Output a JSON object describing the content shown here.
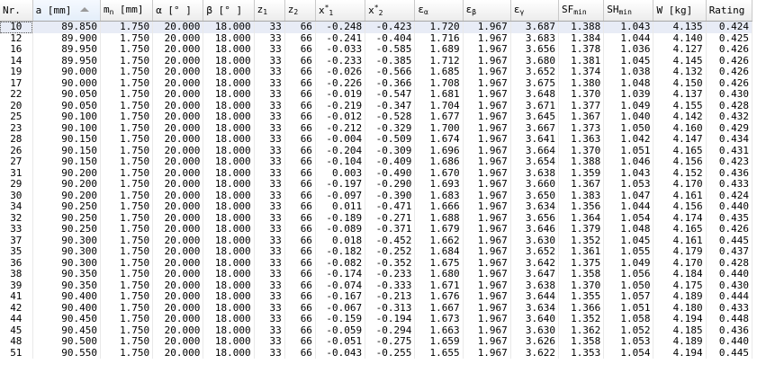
{
  "columns": [
    {
      "key": "nr",
      "label": "Nr."
    },
    {
      "key": "a",
      "label": "a [mm]",
      "sorted": "asc"
    },
    {
      "key": "mn",
      "label": "m",
      "sub": "n",
      "after": " [mm]"
    },
    {
      "key": "alpha",
      "label": "α [° ]"
    },
    {
      "key": "beta",
      "label": "β [° ]"
    },
    {
      "key": "z1",
      "label": "z",
      "sub": "1"
    },
    {
      "key": "z2",
      "label": "z",
      "sub": "2"
    },
    {
      "key": "x1",
      "label": "x",
      "sup": "*",
      "sub": "1"
    },
    {
      "key": "x2",
      "label": "x",
      "sup": "*",
      "sub": "2"
    },
    {
      "key": "ea",
      "label": "ε",
      "sub": "α"
    },
    {
      "key": "eb",
      "label": "ε",
      "sub": "β"
    },
    {
      "key": "eg",
      "label": "ε",
      "sub": "γ"
    },
    {
      "key": "sfmin",
      "label": "SF",
      "sub": "min"
    },
    {
      "key": "shmin",
      "label": "SH",
      "sub": "min"
    },
    {
      "key": "w",
      "label": "W [kg]"
    },
    {
      "key": "rating",
      "label": "Rating"
    }
  ],
  "rows": [
    [
      "10",
      "89.850",
      "1.750",
      "20.000",
      "18.000",
      "33",
      "66",
      "-0.248",
      "-0.423",
      "1.720",
      "1.967",
      "3.687",
      "1.388",
      "1.043",
      "4.135",
      "0.424"
    ],
    [
      "12",
      "89.900",
      "1.750",
      "20.000",
      "18.000",
      "33",
      "66",
      "-0.241",
      "-0.404",
      "1.716",
      "1.967",
      "3.683",
      "1.384",
      "1.044",
      "4.140",
      "0.425"
    ],
    [
      "16",
      "89.950",
      "1.750",
      "20.000",
      "18.000",
      "33",
      "66",
      "-0.033",
      "-0.585",
      "1.689",
      "1.967",
      "3.656",
      "1.378",
      "1.036",
      "4.127",
      "0.426"
    ],
    [
      "14",
      "89.950",
      "1.750",
      "20.000",
      "18.000",
      "33",
      "66",
      "-0.233",
      "-0.385",
      "1.712",
      "1.967",
      "3.680",
      "1.381",
      "1.045",
      "4.145",
      "0.426"
    ],
    [
      "19",
      "90.000",
      "1.750",
      "20.000",
      "18.000",
      "33",
      "66",
      "-0.026",
      "-0.566",
      "1.685",
      "1.967",
      "3.652",
      "1.374",
      "1.038",
      "4.132",
      "0.426"
    ],
    [
      "17",
      "90.000",
      "1.750",
      "20.000",
      "18.000",
      "33",
      "66",
      "-0.226",
      "-0.366",
      "1.708",
      "1.967",
      "3.675",
      "1.380",
      "1.048",
      "4.150",
      "0.426"
    ],
    [
      "22",
      "90.050",
      "1.750",
      "20.000",
      "18.000",
      "33",
      "66",
      "-0.019",
      "-0.547",
      "1.681",
      "1.967",
      "3.648",
      "1.370",
      "1.039",
      "4.137",
      "0.430"
    ],
    [
      "20",
      "90.050",
      "1.750",
      "20.000",
      "18.000",
      "33",
      "66",
      "-0.219",
      "-0.347",
      "1.704",
      "1.967",
      "3.671",
      "1.377",
      "1.049",
      "4.155",
      "0.428"
    ],
    [
      "25",
      "90.100",
      "1.750",
      "20.000",
      "18.000",
      "33",
      "66",
      "-0.012",
      "-0.528",
      "1.677",
      "1.967",
      "3.645",
      "1.367",
      "1.040",
      "4.142",
      "0.432"
    ],
    [
      "23",
      "90.100",
      "1.750",
      "20.000",
      "18.000",
      "33",
      "66",
      "-0.212",
      "-0.329",
      "1.700",
      "1.967",
      "3.667",
      "1.373",
      "1.050",
      "4.160",
      "0.429"
    ],
    [
      "28",
      "90.150",
      "1.750",
      "20.000",
      "18.000",
      "33",
      "66",
      "-0.004",
      "-0.509",
      "1.674",
      "1.967",
      "3.641",
      "1.363",
      "1.042",
      "4.147",
      "0.434"
    ],
    [
      "26",
      "90.150",
      "1.750",
      "20.000",
      "18.000",
      "33",
      "66",
      "-0.204",
      "-0.309",
      "1.696",
      "1.967",
      "3.664",
      "1.370",
      "1.051",
      "4.165",
      "0.431"
    ],
    [
      "27",
      "90.150",
      "1.750",
      "20.000",
      "18.000",
      "33",
      "66",
      "-0.104",
      "-0.409",
      "1.686",
      "1.967",
      "3.654",
      "1.388",
      "1.046",
      "4.156",
      "0.423"
    ],
    [
      "31",
      "90.200",
      "1.750",
      "20.000",
      "18.000",
      "33",
      "66",
      "0.003",
      "-0.490",
      "1.670",
      "1.967",
      "3.638",
      "1.359",
      "1.043",
      "4.152",
      "0.436"
    ],
    [
      "29",
      "90.200",
      "1.750",
      "20.000",
      "18.000",
      "33",
      "66",
      "-0.197",
      "-0.290",
      "1.693",
      "1.967",
      "3.660",
      "1.367",
      "1.053",
      "4.170",
      "0.433"
    ],
    [
      "30",
      "90.200",
      "1.750",
      "20.000",
      "18.000",
      "33",
      "66",
      "-0.097",
      "-0.390",
      "1.683",
      "1.967",
      "3.650",
      "1.383",
      "1.047",
      "4.161",
      "0.424"
    ],
    [
      "34",
      "90.250",
      "1.750",
      "20.000",
      "18.000",
      "33",
      "66",
      "0.011",
      "-0.471",
      "1.666",
      "1.967",
      "3.634",
      "1.356",
      "1.044",
      "4.156",
      "0.440"
    ],
    [
      "32",
      "90.250",
      "1.750",
      "20.000",
      "18.000",
      "33",
      "66",
      "-0.189",
      "-0.271",
      "1.688",
      "1.967",
      "3.656",
      "1.364",
      "1.054",
      "4.174",
      "0.435"
    ],
    [
      "33",
      "90.250",
      "1.750",
      "20.000",
      "18.000",
      "33",
      "66",
      "-0.089",
      "-0.371",
      "1.679",
      "1.967",
      "3.646",
      "1.379",
      "1.048",
      "4.165",
      "0.426"
    ],
    [
      "37",
      "90.300",
      "1.750",
      "20.000",
      "18.000",
      "33",
      "66",
      "0.018",
      "-0.452",
      "1.662",
      "1.967",
      "3.630",
      "1.352",
      "1.045",
      "4.161",
      "0.445"
    ],
    [
      "35",
      "90.300",
      "1.750",
      "20.000",
      "18.000",
      "33",
      "66",
      "-0.182",
      "-0.252",
      "1.684",
      "1.967",
      "3.652",
      "1.361",
      "1.055",
      "4.179",
      "0.437"
    ],
    [
      "36",
      "90.300",
      "1.750",
      "20.000",
      "18.000",
      "33",
      "66",
      "-0.082",
      "-0.352",
      "1.675",
      "1.967",
      "3.642",
      "1.375",
      "1.049",
      "4.170",
      "0.428"
    ],
    [
      "38",
      "90.350",
      "1.750",
      "20.000",
      "18.000",
      "33",
      "66",
      "-0.174",
      "-0.233",
      "1.680",
      "1.967",
      "3.647",
      "1.358",
      "1.056",
      "4.184",
      "0.440"
    ],
    [
      "39",
      "90.350",
      "1.750",
      "20.000",
      "18.000",
      "33",
      "66",
      "-0.074",
      "-0.333",
      "1.671",
      "1.967",
      "3.638",
      "1.370",
      "1.050",
      "4.175",
      "0.430"
    ],
    [
      "41",
      "90.400",
      "1.750",
      "20.000",
      "18.000",
      "33",
      "66",
      "-0.167",
      "-0.213",
      "1.676",
      "1.967",
      "3.644",
      "1.355",
      "1.057",
      "4.189",
      "0.444"
    ],
    [
      "42",
      "90.400",
      "1.750",
      "20.000",
      "18.000",
      "33",
      "66",
      "-0.067",
      "-0.313",
      "1.667",
      "1.967",
      "3.634",
      "1.366",
      "1.051",
      "4.180",
      "0.433"
    ],
    [
      "44",
      "90.450",
      "1.750",
      "20.000",
      "18.000",
      "33",
      "66",
      "-0.159",
      "-0.194",
      "1.673",
      "1.967",
      "3.640",
      "1.352",
      "1.058",
      "4.194",
      "0.448"
    ],
    [
      "45",
      "90.450",
      "1.750",
      "20.000",
      "18.000",
      "33",
      "66",
      "-0.059",
      "-0.294",
      "1.663",
      "1.967",
      "3.630",
      "1.362",
      "1.052",
      "4.185",
      "0.436"
    ],
    [
      "48",
      "90.500",
      "1.750",
      "20.000",
      "18.000",
      "33",
      "66",
      "-0.051",
      "-0.275",
      "1.659",
      "1.967",
      "3.626",
      "1.358",
      "1.053",
      "4.189",
      "0.440"
    ],
    [
      "51",
      "90.550",
      "1.750",
      "20.000",
      "18.000",
      "33",
      "66",
      "-0.043",
      "-0.255",
      "1.655",
      "1.967",
      "3.622",
      "1.353",
      "1.054",
      "4.194",
      "0.445"
    ]
  ],
  "selected_row": 0,
  "colors": {
    "header_bg": "#ececec",
    "selected_row_bg": "#e8ecf6",
    "grid_line": "#c9c9c9"
  }
}
